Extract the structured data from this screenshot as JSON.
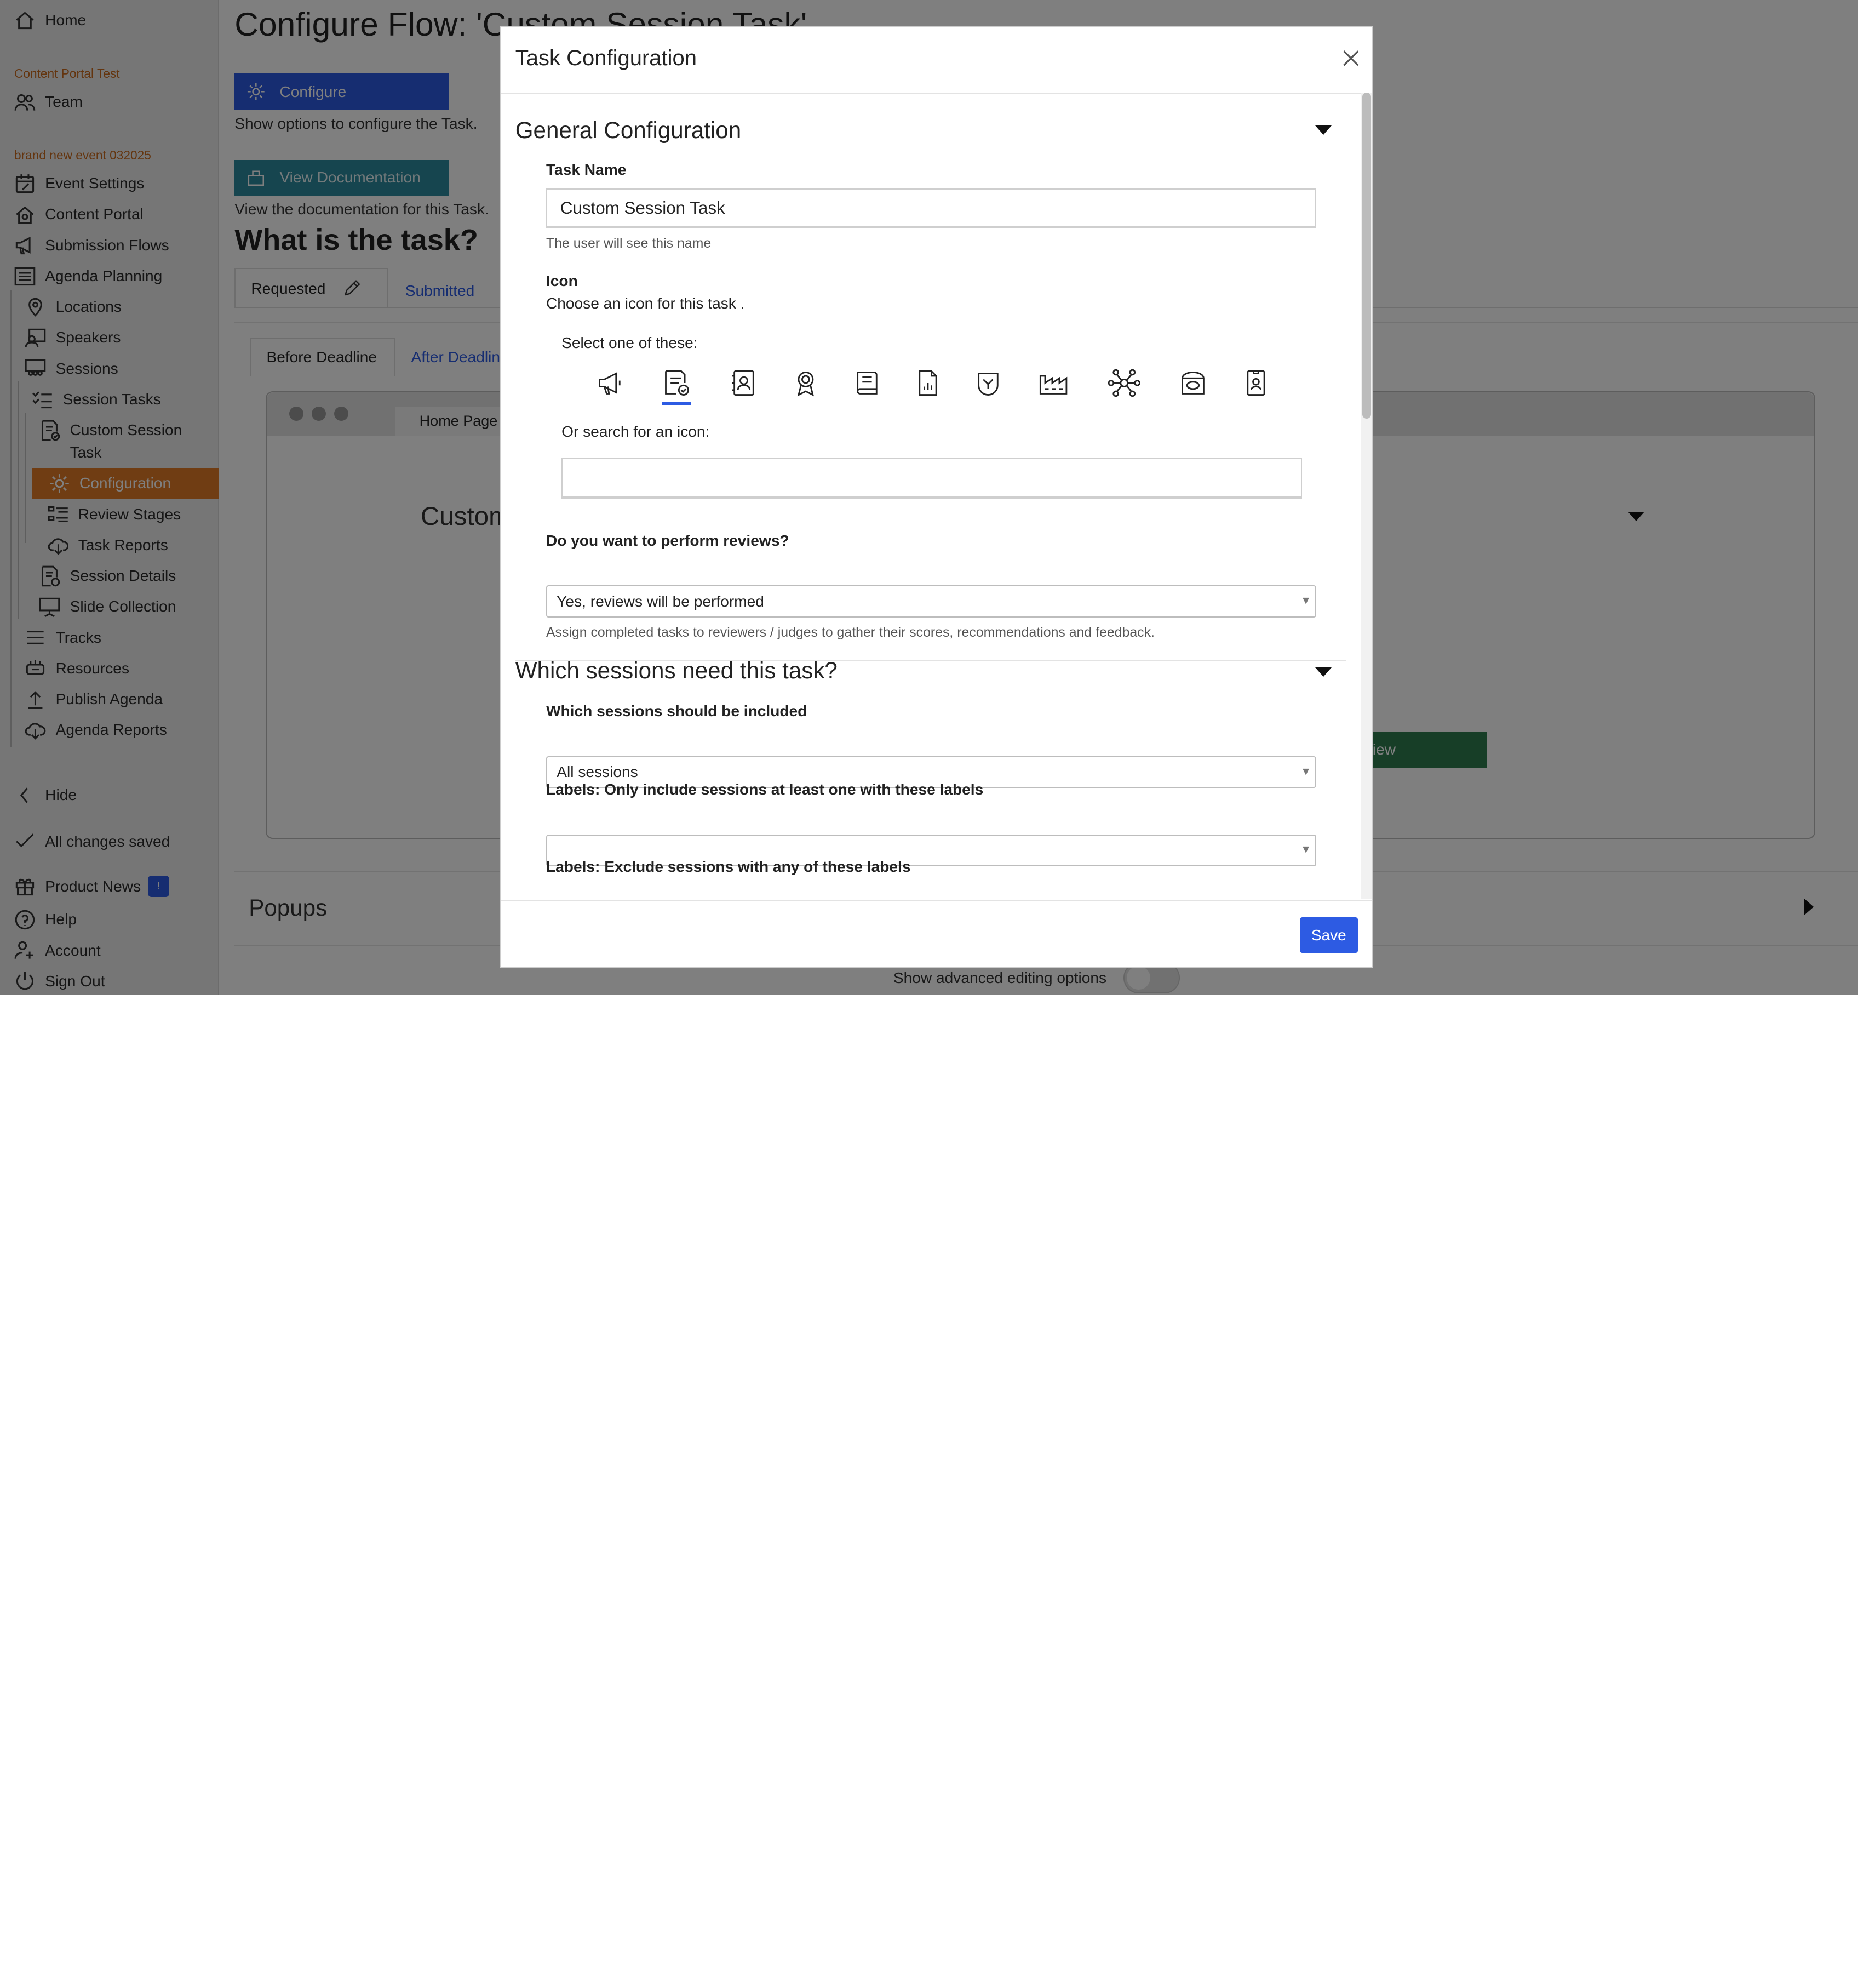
{
  "sidebar": {
    "home": "Home",
    "portal_section": "Content Portal Test",
    "team": "Team",
    "event_section": "brand new event 032025",
    "items": [
      {
        "label": "Event Settings",
        "icon": "calendar-edit-icon"
      },
      {
        "label": "Content Portal",
        "icon": "home-icon"
      },
      {
        "label": "Submission Flows",
        "icon": "megaphone-icon"
      },
      {
        "label": "Agenda Planning",
        "icon": "list-icon"
      },
      {
        "label": "Locations",
        "icon": "location-pin-icon"
      },
      {
        "label": "Speakers",
        "icon": "speaker-icon"
      },
      {
        "label": "Sessions",
        "icon": "sessions-icon"
      },
      {
        "label": "Session Tasks",
        "icon": "checklist-icon"
      },
      {
        "label": "Custom Session",
        "label2": "Task",
        "icon": "task-icon"
      },
      {
        "label": "Configuration",
        "icon": "gear-icon"
      },
      {
        "label": "Review Stages",
        "icon": "review-stages-icon"
      },
      {
        "label": "Task Reports",
        "icon": "download-cloud-icon"
      },
      {
        "label": "Session Details",
        "icon": "details-icon"
      },
      {
        "label": "Slide Collection",
        "icon": "presentation-icon"
      },
      {
        "label": "Tracks",
        "icon": "tracks-icon"
      },
      {
        "label": "Resources",
        "icon": "resources-icon"
      },
      {
        "label": "Publish Agenda",
        "icon": "publish-icon"
      },
      {
        "label": "Agenda Reports",
        "icon": "download-cloud-icon"
      }
    ],
    "hide": "Hide",
    "saved": "All changes saved",
    "product_news": "Product News",
    "product_news_badge": "!",
    "help": "Help",
    "account": "Account",
    "sign_out": "Sign Out"
  },
  "main": {
    "title": "Configure Flow: 'Custom Session Task'",
    "configure_btn": "Configure",
    "configure_desc": "Show options to configure the Task.",
    "docs_btn": "View Documentation",
    "docs_desc": "View the documentation for this Task.",
    "what_title": "What is the task?",
    "tab_requested": "Requested",
    "tab_submitted": "Submitted",
    "subtab_before": "Before Deadline",
    "subtab_after": "After Deadline",
    "preview_tab": "Home Page",
    "preview_heading": "Custom",
    "preview_btn": "View",
    "popups": "Popups",
    "advanced": "Show advanced editing options"
  },
  "modal": {
    "title": "Task Configuration",
    "general_title": "General Configuration",
    "task_name_label": "Task Name",
    "task_name_value": "Custom Session Task",
    "task_name_help": "The user will see this name",
    "icon_label": "Icon",
    "icon_desc": "Choose an icon for this task .",
    "select_one": "Select one of these:",
    "icons": [
      "megaphone-icon",
      "task-check-icon",
      "contact-card-icon",
      "award-icon",
      "book-icon",
      "file-chart-icon",
      "logo-badge-icon",
      "factory-icon",
      "network-icon",
      "cake-icon",
      "id-badge-icon"
    ],
    "selected_icon_index": 1,
    "search_label": "Or search for an icon:",
    "search_value": "",
    "reviews_label": "Do you want to perform reviews?",
    "reviews_value": "Yes, reviews will be performed",
    "reviews_help": "Assign completed tasks to reviewers / judges to gather their scores, recommendations and feedback.",
    "sessions_title": "Which sessions need this task?",
    "included_label": "Which sessions should be included",
    "included_value": "All sessions",
    "labels_include": "Labels: Only include sessions at least one with these labels",
    "labels_include_value": "",
    "labels_exclude": "Labels: Exclude sessions with any of these labels",
    "save": "Save"
  },
  "colors": {
    "accent": "#2d5be3",
    "active": "#e07b27",
    "teal": "#2c8a9e",
    "green": "#2e7d4f"
  }
}
